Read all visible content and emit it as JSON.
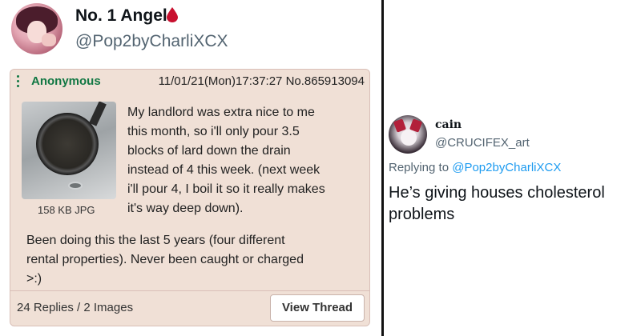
{
  "tweet": {
    "author_name": "No. 1 Angel",
    "author_handle": "@Pop2byCharliXCX",
    "name_emoji": "drop-of-blood-icon"
  },
  "post": {
    "poster_name": "Anonymous",
    "meta": "11/01/21(Mon)17:37:27 No.865913094",
    "image_caption": "158 KB JPG",
    "body_lines": [
      "My landlord was extra nice to me",
      "this month, so i'll only pour 3.5",
      "blocks of lard down the drain",
      "instead of 4 this week. (next week",
      "i'll pour 4, I boil it so it really makes",
      "it's way deep down)."
    ],
    "body2_lines": [
      "Been doing this the last 5 years (four different",
      "rental properties). Never been caught or charged",
      ">:)"
    ],
    "footer_stats": "24 Replies / 2 Images",
    "view_thread_label": "View Thread",
    "colors": {
      "card_bg": "#f0e0d6",
      "name_green": "#117743"
    }
  },
  "reply": {
    "author_name": "cain",
    "author_handle": "@CRUCIFEX_art",
    "replying_prefix": "Replying to ",
    "replying_handle": "@Pop2byCharliXCX",
    "text_lines": [
      "He’s giving houses cholesterol",
      "problems"
    ],
    "link_color": "#1d9bf0"
  }
}
